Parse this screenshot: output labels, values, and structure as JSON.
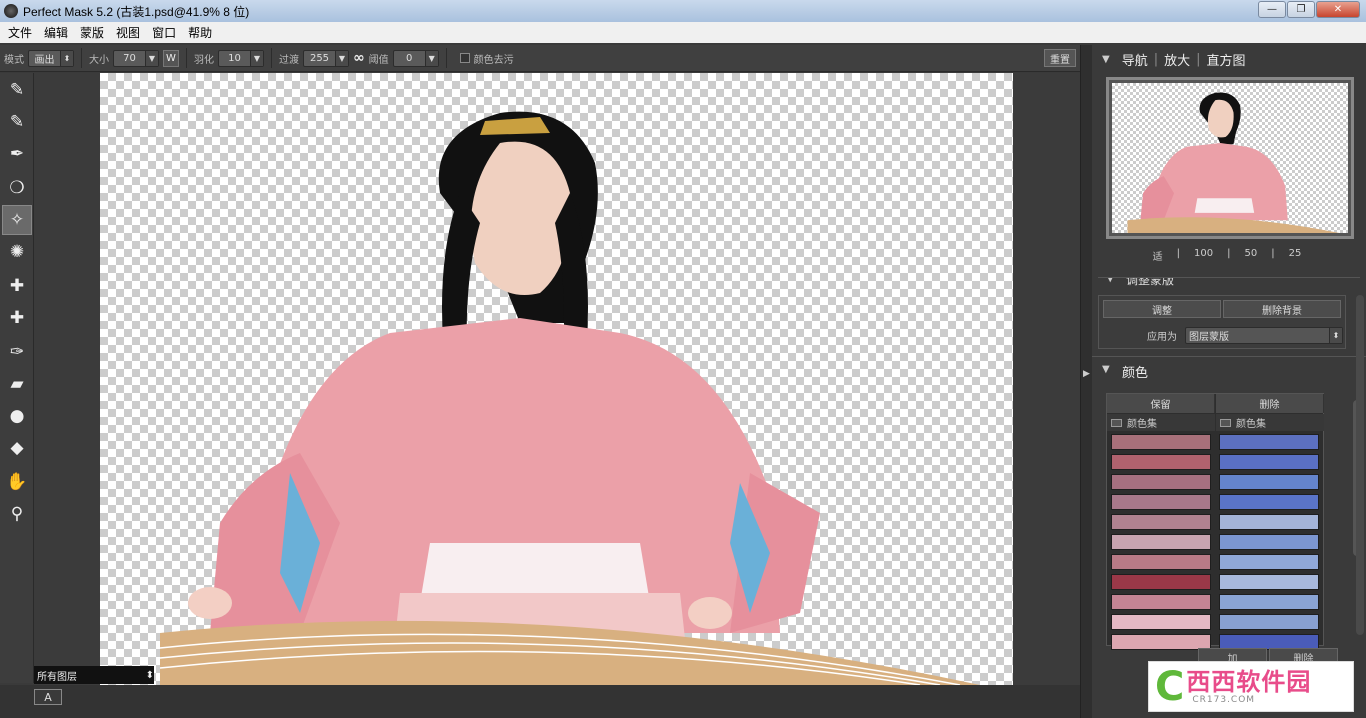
{
  "window": {
    "title": "Perfect Mask 5.2 (古装1.psd@41.9% 8 位)",
    "minimize": "—",
    "restore": "❐",
    "close": "✕"
  },
  "menu": [
    "文件",
    "编辑",
    "蒙版",
    "视图",
    "窗口",
    "帮助"
  ],
  "options": {
    "mode_label": "模式",
    "mode_value": "画出",
    "size_label": "大小",
    "size_value": "70",
    "w_button": "W",
    "feather_label": "羽化",
    "feather_value": "10",
    "transition_label": "过渡",
    "transition_value": "255",
    "threshold_label": "阈值",
    "threshold_value": "0",
    "decontaminate_label": "颜色去污",
    "reset_button": "重置"
  },
  "tools": [
    {
      "name": "keep-brush-icon",
      "glyph": "✎"
    },
    {
      "name": "drop-brush-icon",
      "glyph": "✎"
    },
    {
      "name": "magic-brush-icon",
      "glyph": "✒"
    },
    {
      "name": "keep-color-icon",
      "glyph": "❍"
    },
    {
      "name": "magic-wand-brush-icon",
      "glyph": "✧"
    },
    {
      "name": "splatter-icon",
      "glyph": "✺"
    },
    {
      "name": "keep-eyedropper-icon",
      "glyph": "✚"
    },
    {
      "name": "drop-eyedropper-icon",
      "glyph": "✚"
    },
    {
      "name": "pen-icon",
      "glyph": "✑"
    },
    {
      "name": "eraser-icon",
      "glyph": "▰"
    },
    {
      "name": "blur-drop-icon",
      "glyph": "●"
    },
    {
      "name": "fill-bucket-icon",
      "glyph": "◆"
    },
    {
      "name": "hand-icon",
      "glyph": "✋"
    },
    {
      "name": "zoom-icon",
      "glyph": "⚲"
    }
  ],
  "active_tool_index": 4,
  "layer_select": "所有图层",
  "status": {
    "a_button": "A"
  },
  "navigator": {
    "tab_nav": "导航",
    "tab_zoom": "放大",
    "tab_hist": "直方图",
    "sep": "|",
    "zoom_levels": [
      "适",
      "100",
      "50",
      "25"
    ]
  },
  "adjust": {
    "title": "调整蒙版",
    "adjust_button": "调整",
    "remove_bg_button": "删除背景",
    "apply_label": "应用为",
    "apply_value": "图层蒙版"
  },
  "colors": {
    "title": "颜色",
    "keep_header": "保留",
    "drop_header": "删除",
    "set_label": "颜色集",
    "keep_swatches": [
      "#a8707a",
      "#b0626e",
      "#a67080",
      "#a8788a",
      "#b08290",
      "#c8a4b0",
      "#b87a86",
      "#9a3848",
      "#c48494",
      "#e4b8c4",
      "#dca6b0"
    ],
    "drop_swatches": [
      "#5c70c0",
      "#5a70c4",
      "#6484cc",
      "#5a74c8",
      "#a4b4d8",
      "#7c96d0",
      "#90a8d8",
      "#a8b8dc",
      "#8aa4d4",
      "#88a0d0",
      "#4a5cb8"
    ],
    "add_button": "加",
    "remove_button": "删除"
  },
  "watermark": {
    "letter": "C",
    "brand": "西西软件园",
    "url": "CR173.COM"
  }
}
